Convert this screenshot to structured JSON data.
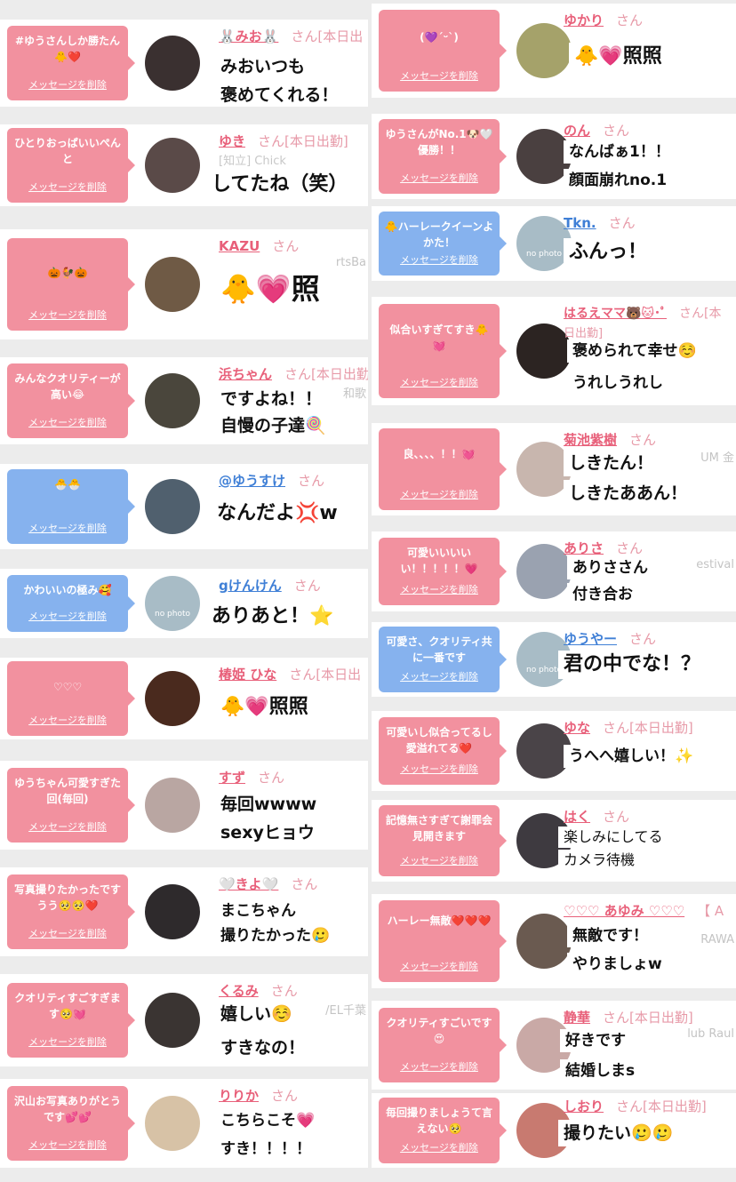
{
  "delete_label": "メッセージを削除",
  "colors": {
    "pink_bubble": "#f2919f",
    "blue_bubble": "#86b2ee",
    "name_pink": "#e8607a",
    "name_blue": "#3f7fd6"
  },
  "left": [
    {
      "bubble": "#ゆうさんしか勝たん🐥❤️",
      "name": "🐰みお🐰",
      "suffix": "さん[本日出",
      "sub": "",
      "side": "",
      "label1": "みおいつも",
      "label2": "褒めてくれる！",
      "avatar": "#3a3030"
    },
    {
      "bubble": "ひとりおっぱいいぺんと",
      "name": "ゆき",
      "suffix": "さん[本日出勤]",
      "sub": "[知立] Chick",
      "side": "",
      "label1": "してたね（笑）",
      "label2": "",
      "avatar": "#5a4a48"
    },
    {
      "bubble": "🎃🐓🎃",
      "name": "KAZU",
      "suffix": "さん",
      "sub": "",
      "side": "rtsBa",
      "label1": "🐥💗照",
      "label2": "",
      "avatar": "#6f5a45"
    },
    {
      "bubble": "みんなクオリティーが高い😂",
      "name": "浜ちゃん",
      "suffix": "さん[本日出勤",
      "sub": "",
      "side": "和歌",
      "label1": "ですよね！！",
      "label2": "自慢の子達🍭",
      "avatar": "#4a463c"
    },
    {
      "bubble": "🐣🐣",
      "name": "@ゆうすけ",
      "suffix": "さん",
      "sub": "",
      "side": "",
      "label1": "なんだよ💢w",
      "label2": "",
      "avatar": "#50606e"
    },
    {
      "bubble": "かわいいの極み🥰",
      "name": "gけんけん",
      "suffix": "さん",
      "sub": "",
      "side": "",
      "label1": "ありあと！⭐",
      "label2": "",
      "avatar": "#a8bcc6"
    },
    {
      "bubble": "♡♡♡",
      "name": "椿姫 ひな",
      "suffix": "さん[本日出",
      "sub": "",
      "side": "",
      "label1": "🐥💗照照",
      "label2": "",
      "avatar": "#4a2a1e"
    },
    {
      "bubble": "ゆうちゃん可愛すぎた回(毎回)",
      "name": "すず",
      "suffix": "さん",
      "sub": "",
      "side": "",
      "label1": "毎回wwww",
      "label2": "sexyヒョウ",
      "avatar": "#b9a6a2"
    },
    {
      "bubble": "写真撮りたかったですうう🥺🥺❤️",
      "name": "🤍きよ🤍",
      "suffix": "さん",
      "sub": "",
      "side": "",
      "label1": "まこちゃん",
      "label2": "撮りたかった🥲",
      "avatar": "#2e2a2c"
    },
    {
      "bubble": "クオリティすごすぎます🥺💓",
      "name": "くるみ",
      "suffix": "さん",
      "sub": "",
      "side": "/EL千葉",
      "label1": "嬉しい☺️",
      "label2": "すきなの！",
      "avatar": "#3a3432"
    },
    {
      "bubble": "沢山お写真ありがとうです💕💕",
      "name": "りりか",
      "suffix": "さん",
      "sub": "",
      "side": "",
      "label1": "こちらこそ💗",
      "label2": "すき！！！！",
      "avatar": "#d7c2a6"
    }
  ],
  "right": [
    {
      "bubble": "(💜ˊᵕˋ)",
      "name": "ゆかり",
      "suffix": "さん",
      "sub": "",
      "side": "",
      "label1": "🐥💗照照",
      "label2": "",
      "avatar": "#a5a26a"
    },
    {
      "bubble": "ゆうさんがNo.1🐶🤍優勝！！",
      "name": "のん",
      "suffix": "さん",
      "sub": "",
      "side": "",
      "label1": "なんばぁ1！！",
      "label2": "顔面崩れno.1",
      "avatar": "#4a4040"
    },
    {
      "bubble": "🐥ハーレークイーンよかた！",
      "name": "Tkn.",
      "suffix": "さん",
      "sub": "",
      "side": "",
      "label1": "ふんっ！",
      "label2": "",
      "avatar": "#a8bcc6",
      "blue": true
    },
    {
      "bubble": "似合いすぎてすき🐥💓",
      "name": "はるえママ🐻🐱･ﾟ",
      "suffix": "さん[本",
      "sub": "日出勤]",
      "side": "",
      "label1": "褒められて幸せ☺️",
      "label2": "うれしうれし",
      "avatar": "#2c2422"
    },
    {
      "bubble": "良、、、、！！💓",
      "name": "菊池紫樹",
      "suffix": "さん",
      "sub": "",
      "side": "UM 金",
      "label1": "しきたん！",
      "label2": "しきたああん！",
      "avatar": "#c8b6ae"
    },
    {
      "bubble": "可愛いいいいい！！！！！💗",
      "name": "ありさ",
      "suffix": "さん",
      "sub": "",
      "side": "estival",
      "label1": "ありささん",
      "label2": "付き合お",
      "avatar": "#9aa2b0"
    },
    {
      "bubble": "可愛さ、クオリティ共に一番です",
      "name": "ゆうやー",
      "suffix": "さん",
      "sub": "",
      "side": "",
      "label1": "君の中でな！？",
      "label2": "",
      "avatar": "#a8bcc6",
      "blue": true
    },
    {
      "bubble": "可愛いし似合ってるし愛溢れてる❤️",
      "name": "ゆな",
      "suffix": "さん[本日出勤]",
      "sub": "",
      "side": "",
      "label1": "うへへ嬉しい！✨",
      "label2": "",
      "avatar": "#4a4448"
    },
    {
      "bubble": "記憶無さすぎて謝罪会見開きます",
      "name": "はく",
      "suffix": "さん",
      "sub": "",
      "side": "",
      "label1": "楽しみにしてる",
      "label2": "カメラ待機",
      "avatar": "#3e3a40"
    },
    {
      "bubble": "ハーレー無敵❤️❤️❤️",
      "name": "♡♡♡ あゆみ ♡♡♡",
      "suffix": "【 A",
      "sub": "",
      "side": "RAWA",
      "label1": "無敵です！",
      "label2": "やりましょw",
      "avatar": "#6a5a50"
    },
    {
      "bubble": "クオリティすごいです😍",
      "name": "静華",
      "suffix": "さん[本日出勤]",
      "sub": "",
      "side": "lub Raul",
      "label1": "好きです",
      "label2": "結婚しまs",
      "avatar": "#c9a9a6"
    },
    {
      "bubble": "毎回撮りましょうて言えない🥺",
      "name": "しおり",
      "suffix": "さん[本日出勤]",
      "sub": "",
      "side": "",
      "label1": "撮りたい🥲🥲",
      "label2": "",
      "avatar": "#c87a70"
    }
  ]
}
